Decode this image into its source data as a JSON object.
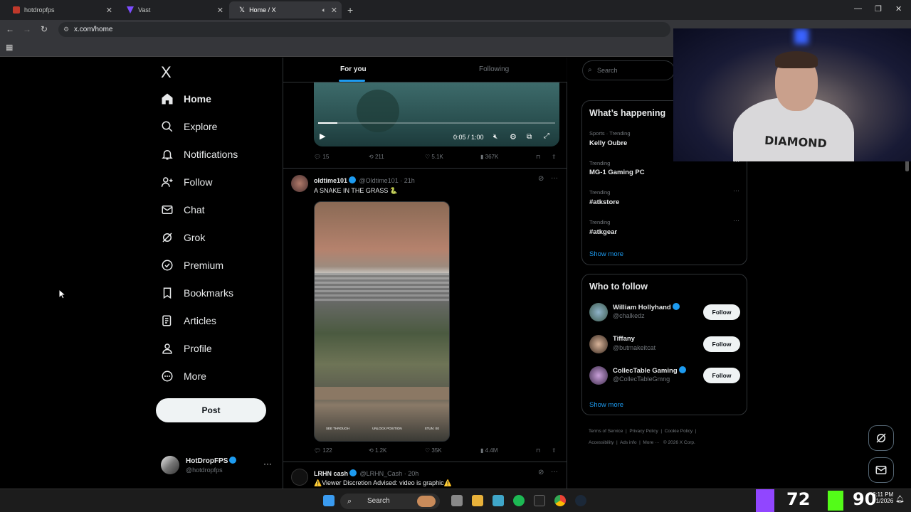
{
  "browser": {
    "tabs": [
      {
        "title": "hotdropfps"
      },
      {
        "title": "Vast"
      },
      {
        "title": "Home / X"
      }
    ],
    "new_tab": "+",
    "url": "x.com/home"
  },
  "sidebar": {
    "logo": "X",
    "items": [
      {
        "label": "Home",
        "icon": "home-icon"
      },
      {
        "label": "Explore",
        "icon": "search-icon"
      },
      {
        "label": "Notifications",
        "icon": "bell-icon"
      },
      {
        "label": "Follow",
        "icon": "person-add-icon"
      },
      {
        "label": "Chat",
        "icon": "mail-icon"
      },
      {
        "label": "Grok",
        "icon": "grok-icon"
      },
      {
        "label": "Premium",
        "icon": "verified-icon"
      },
      {
        "label": "Bookmarks",
        "icon": "bookmark-icon"
      },
      {
        "label": "Articles",
        "icon": "article-icon"
      },
      {
        "label": "Profile",
        "icon": "person-icon"
      },
      {
        "label": "More",
        "icon": "more-circle-icon"
      }
    ],
    "post_label": "Post",
    "account": {
      "name": "HotDropFPS",
      "handle": "@hotdropfps",
      "more": "···"
    }
  },
  "timeline": {
    "tabs": [
      "For you",
      "Following"
    ],
    "video1": {
      "time": "0:05 / 1:00",
      "progress": 0.08
    },
    "tweet1_actions": {
      "replies": "15",
      "reposts": "211",
      "likes": "5.1K",
      "views": "367K"
    },
    "tweet2": {
      "name": "oldtime101",
      "handle": "@Oldtime101",
      "time": "· 21h",
      "text": "A SNAKE IN THE GRASS 🐍",
      "hud": [
        "SEE THROUGH",
        "UNLOCK POSITION",
        "STUN: X0"
      ],
      "actions": {
        "replies": "122",
        "reposts": "1.2K",
        "likes": "35K",
        "views": "4.4M"
      }
    },
    "tweet3": {
      "name": "LRHN cash",
      "handle": "@LRHN_Cash",
      "time": "· 20h",
      "text": "⚠️Viewer Discretion Advised: video is graphic⚠️"
    }
  },
  "right": {
    "search_placeholder": "Search",
    "happening_title": "What’s happening",
    "trends": [
      {
        "meta": "Sports · Trending",
        "name": "Kelly Oubre"
      },
      {
        "meta": "Trending",
        "name": "MG-1 Gaming PC"
      },
      {
        "meta": "Trending",
        "name": "#atkstore"
      },
      {
        "meta": "Trending",
        "name": "#atkgear"
      }
    ],
    "show_more": "Show more",
    "wtf_title": "Who to follow",
    "wtf": [
      {
        "name": "William Hollyhand",
        "handle": "@chalkedz",
        "verified": true
      },
      {
        "name": "Tiffany",
        "handle": "@butmakeitcat",
        "verified": false
      },
      {
        "name": "CollecTable Gaming",
        "handle": "@CollecTableGmng",
        "verified": true
      }
    ],
    "follow_label": "Follow",
    "footer": [
      "Terms of Service",
      "Privacy Policy",
      "Cookie Policy",
      "Accessibility",
      "Ads info",
      "More ···",
      "© 2026 X Corp."
    ]
  },
  "webcam": {
    "shirt_text": "DIAMOND"
  },
  "taskbar": {
    "search": "Search",
    "stat1": "72",
    "stat2": "90",
    "clock_time": "6:11 PM",
    "clock_date": "1/2026"
  },
  "colors": {
    "accent": "#1d9bf0",
    "twitch": "#9146ff",
    "kick": "#53fc18"
  }
}
